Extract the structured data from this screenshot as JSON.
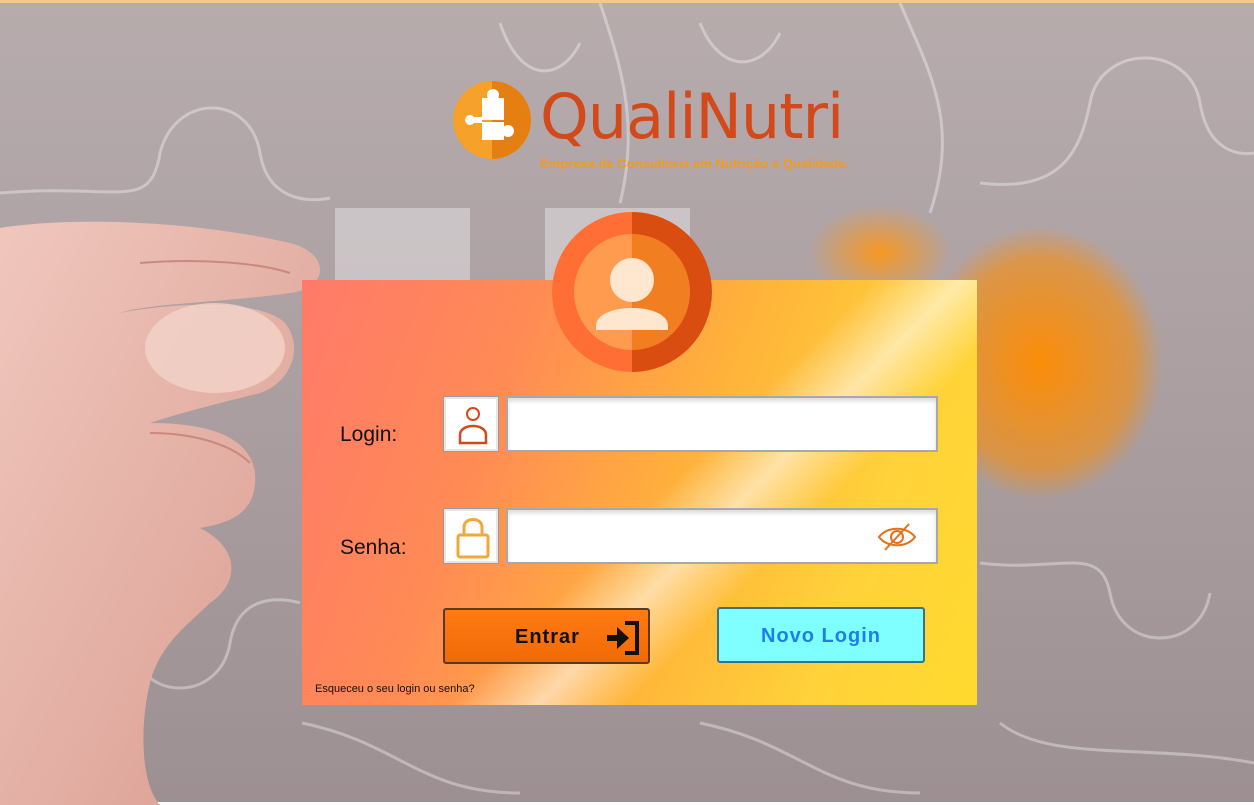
{
  "brand": {
    "name": "QualiNutri",
    "tagline": "Empresa de Consultoria em Nutrição e Qualidade."
  },
  "form": {
    "login_label": "Login:",
    "login_value": "",
    "password_label": "Senha:",
    "password_value": "",
    "enter_button": "Entrar",
    "new_login_button": "Novo Login",
    "forgot_link": "Esqueceu o seu login ou senha?"
  },
  "icons": {
    "logo": "puzzle-logo-icon",
    "avatar": "user-avatar-icon",
    "login": "user-icon",
    "password": "lock-icon",
    "toggle_password": "eye-slash-icon",
    "enter": "sign-in-icon"
  },
  "colors": {
    "brand_red": "#d2491a",
    "brand_orange": "#f29a1f",
    "enter_button": "#ff7b14",
    "new_login_button": "#7fffff",
    "new_login_text": "#1e7fe8"
  }
}
